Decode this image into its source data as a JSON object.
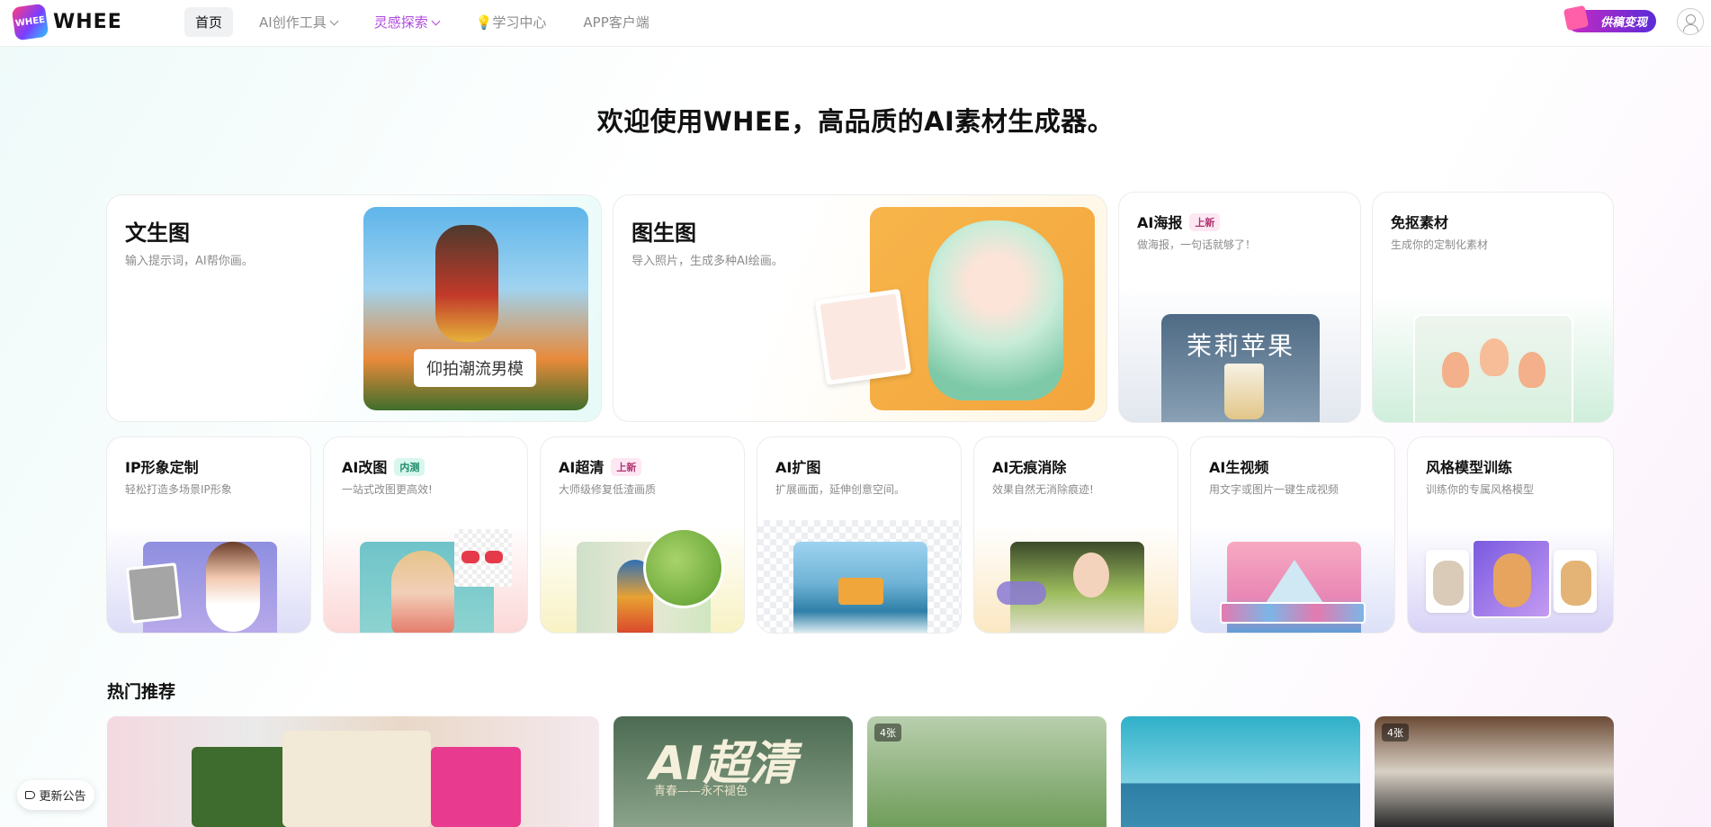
{
  "header": {
    "logo_mark": "WHEE",
    "logo_text": "WHEE",
    "nav": [
      {
        "label": "首页"
      },
      {
        "label": "AI创作工具"
      },
      {
        "label": "灵感探索"
      },
      {
        "label": "💡学习中心"
      },
      {
        "label": "APP客户端"
      }
    ],
    "promo_label": "供稿变现"
  },
  "hero": {
    "title": "欢迎使用WHEE，高品质的AI素材生成器。"
  },
  "features_large": [
    {
      "title": "文生图",
      "subtitle": "输入提示词，AI帮你画。",
      "image_caption": "仰拍潮流男模"
    },
    {
      "title": "图生图",
      "subtitle": "导入照片，生成多种AI绘画。"
    },
    {
      "title": "AI海报",
      "badge": "上新",
      "subtitle": "做海报，一句话就够了！",
      "image_text": "茉莉苹果"
    },
    {
      "title": "免抠素材",
      "subtitle": "生成你的定制化素材"
    }
  ],
  "features_small": [
    {
      "title": "IP形象定制",
      "subtitle": "轻松打造多场景IP形象"
    },
    {
      "title": "AI改图",
      "badge": "内测",
      "subtitle": "一站式改图更高效!"
    },
    {
      "title": "AI超清",
      "badge": "上新",
      "subtitle": "大师级修复低渣画质"
    },
    {
      "title": "AI扩图",
      "subtitle": "扩展画面，延伸创意空间。"
    },
    {
      "title": "AI无痕消除",
      "subtitle": "效果自然无消除痕迹!"
    },
    {
      "title": "AI生视频",
      "subtitle": "用文字或图片一键生成视频"
    },
    {
      "title": "风格模型训练",
      "subtitle": "训练你的专属风格模型"
    }
  ],
  "recommend": {
    "title": "热门推荐",
    "items": [
      {
        "count": ""
      },
      {
        "count": "",
        "overlay_text": "AI超清",
        "overlay_sub": "青春——永不褪色"
      },
      {
        "count": "4张"
      },
      {
        "count": ""
      },
      {
        "count": "4张"
      }
    ]
  },
  "notice": {
    "label": "更新公告"
  },
  "colors": {
    "accent_purple": "#b14ae0",
    "badge_new_bg": "#fde7f3",
    "badge_beta_bg": "#d9f7ef"
  }
}
